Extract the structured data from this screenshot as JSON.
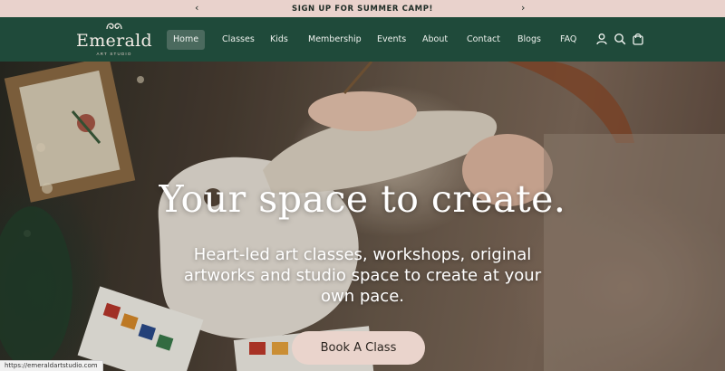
{
  "announcement": {
    "text": "SIGN UP FOR SUMMER CAMP!",
    "prev_icon": "chevron-left-icon",
    "next_icon": "chevron-right-icon"
  },
  "brand": {
    "name": "Emerald",
    "tagline": "ART STUDIO"
  },
  "nav": {
    "items": [
      {
        "label": "Home",
        "active": true
      },
      {
        "label": "Classes"
      },
      {
        "label": "Kids"
      },
      {
        "label": "Membership"
      },
      {
        "label": "Events"
      },
      {
        "label": "About"
      },
      {
        "label": "Contact"
      },
      {
        "label": "Blogs"
      },
      {
        "label": "FAQ"
      }
    ],
    "icons": [
      "account-icon",
      "search-icon",
      "cart-icon"
    ]
  },
  "hero": {
    "title": "Your space to create.",
    "subtitle": "Heart-led art classes, workshops, original artworks and studio space to create at your own pace.",
    "cta_label": "Book A Class"
  },
  "status_bar": {
    "url": "https://emeraldartstudio.com"
  },
  "colors": {
    "header_bg": "#1f4a3a",
    "announcement_bg": "#e9d2cc",
    "cta_bg": "#ead4cc",
    "active_nav_bg": "#4b6a5e"
  }
}
